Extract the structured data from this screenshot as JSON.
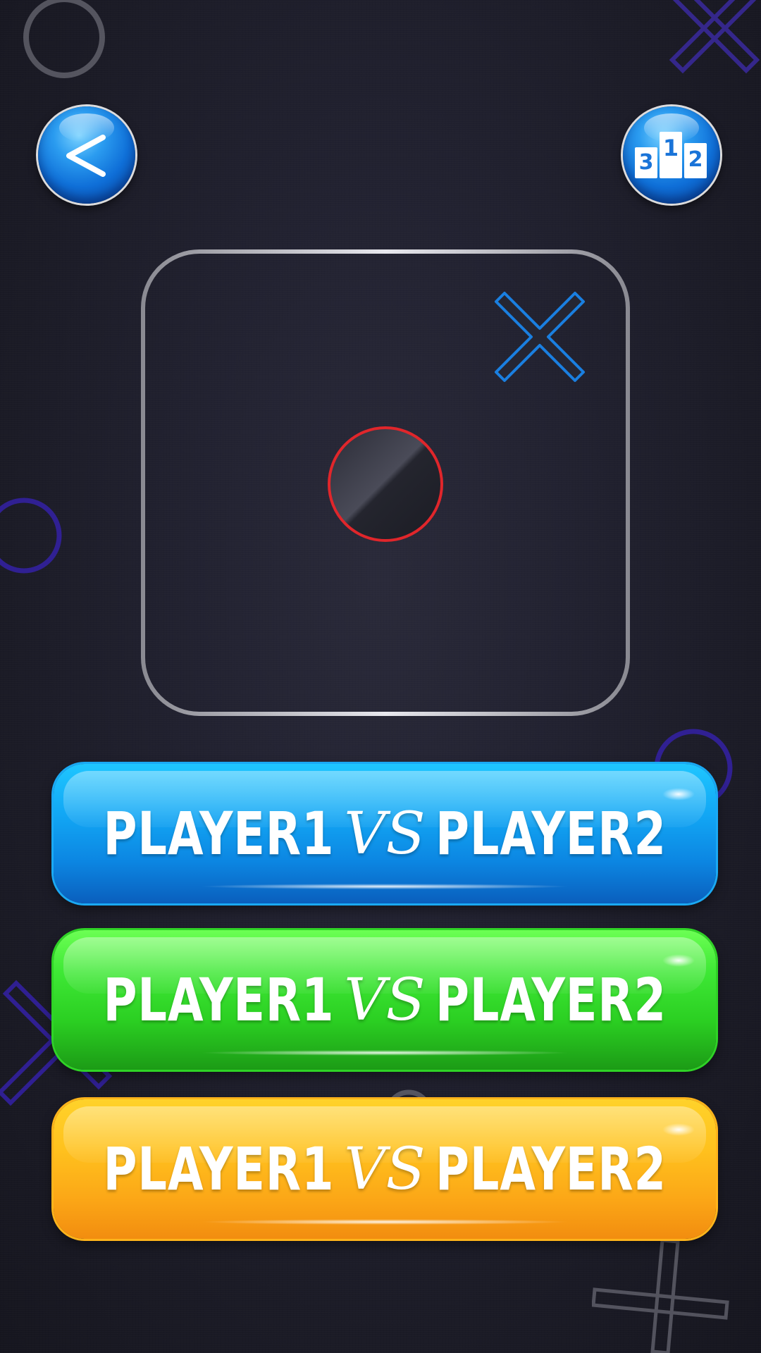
{
  "header": {
    "back_button": {
      "icon": "back-chevron-icon",
      "glyph": "<"
    },
    "leaderboard_button": {
      "icon": "podium-icon",
      "ranks": [
        "3",
        "1",
        "2"
      ]
    }
  },
  "board": {
    "cells": [
      "",
      "",
      "X",
      "",
      "O",
      "",
      "",
      "",
      ""
    ],
    "x_color": "#1a7fe0",
    "o_color": "#e0262b"
  },
  "modes": [
    {
      "left": "PLAYER1",
      "vs": "VS",
      "right": "PLAYER2",
      "color": "blue"
    },
    {
      "left": "PLAYER1",
      "vs": "VS",
      "right": "PLAYER2",
      "color": "green"
    },
    {
      "left": "PLAYER1",
      "vs": "VS",
      "right": "PLAYER2",
      "color": "orange"
    }
  ]
}
